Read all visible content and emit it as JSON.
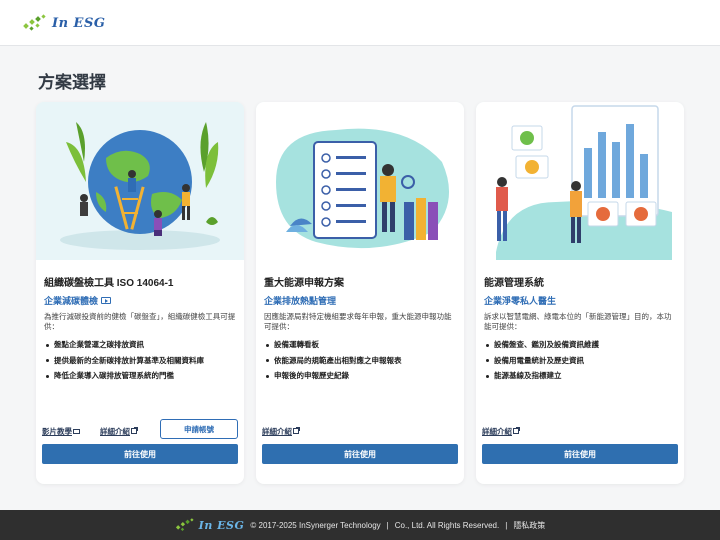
{
  "header": {
    "logo_text": "In ESG"
  },
  "page": {
    "title": "方案選擇"
  },
  "cards": [
    {
      "title": "組織碳盤檢工具 ISO 14064-1",
      "subtitle": "企業減碳體檢",
      "desc": "為推行減碳投資前的健檢「碳盤查」，組織碳健檢工具可提供：",
      "bullets": [
        "盤點企業營運之碳排放資訊",
        "提供最新的全新碳排放計算基準及相關資料庫",
        "降低企業導入碳排放管理系統的門檻"
      ],
      "link_video": "影片教學",
      "link_detail": "詳細介紹",
      "apply_label": "申請帳號",
      "go_label": "前往使用"
    },
    {
      "title": "重大能源申報方案",
      "subtitle": "企業排放熱點管理",
      "desc": "因應能源局對特定機組要求每年申報，重大能源申報功能可提供：",
      "bullets": [
        "設備運轉看板",
        "依能源局的規範產出相對應之申報報表",
        "申報後的申報歷史紀錄"
      ],
      "link_detail": "詳細介紹",
      "go_label": "前往使用"
    },
    {
      "title": "能源管理系統",
      "subtitle": "企業淨零私人醫生",
      "desc": "訴求以智慧電網、綠電本位的「新能源管理」目的，本功能可提供：",
      "bullets": [
        "設備盤查、鑑別及設備資訊維護",
        "設備用電量統計及歷史資訊",
        "能源基線及指標建立"
      ],
      "link_detail": "詳細介紹",
      "go_label": "前往使用"
    }
  ],
  "footer": {
    "logo_text": "In ESG",
    "copyright": "© 2017-2025 InSynerger Technology",
    "company": "Co., Ltd. All Rights Reserved.",
    "privacy": "隱私政策"
  },
  "colors": {
    "primary": "#2f6fb0",
    "accent_text": "#2f6db5",
    "footer_bg": "#2f2f2f",
    "page_bg": "#f5f6f7"
  }
}
